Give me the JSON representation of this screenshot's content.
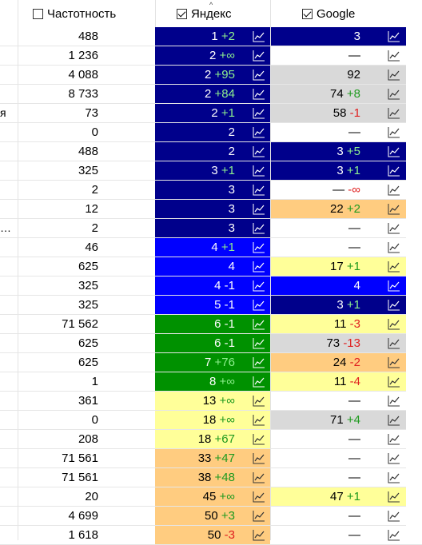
{
  "header": {
    "frequency_label": "Частотность",
    "frequency_checked": false,
    "yandex_label": "Яндекс",
    "yandex_checked": true,
    "google_label": "Google",
    "google_checked": true,
    "sort_indicator": "^"
  },
  "colors": {
    "navy": "#00008b",
    "blue": "#0000ff",
    "green": "#009100",
    "yellow": "#ffff99",
    "orange": "#ffcc80",
    "gray": "#d9d9d9",
    "delta_up": "#1f9a1f",
    "delta_down": "#e02020"
  },
  "rows": [
    {
      "kw": "",
      "freq": "488",
      "y": {
        "pos": "1",
        "d": "+2",
        "bg": "navy"
      },
      "g": {
        "pos": "3",
        "d": "",
        "bg": "navy"
      }
    },
    {
      "kw": "",
      "freq": "1 236",
      "y": {
        "pos": "2",
        "d": "+∞",
        "bg": "navy"
      },
      "g": {
        "pos": "—",
        "d": "",
        "bg": "white"
      }
    },
    {
      "kw": "",
      "freq": "4 088",
      "y": {
        "pos": "2",
        "d": "+95",
        "bg": "navy"
      },
      "g": {
        "pos": "92",
        "d": "",
        "bg": "gray"
      }
    },
    {
      "kw": "",
      "freq": "8 733",
      "y": {
        "pos": "2",
        "d": "+84",
        "bg": "navy"
      },
      "g": {
        "pos": "74",
        "d": "+8",
        "bg": "gray"
      }
    },
    {
      "kw": "я",
      "freq": "73",
      "y": {
        "pos": "2",
        "d": "+1",
        "bg": "navy"
      },
      "g": {
        "pos": "58",
        "d": "-1",
        "bg": "gray"
      }
    },
    {
      "kw": "",
      "freq": "0",
      "y": {
        "pos": "2",
        "d": "",
        "bg": "navy"
      },
      "g": {
        "pos": "—",
        "d": "",
        "bg": "white"
      }
    },
    {
      "kw": "",
      "freq": "488",
      "y": {
        "pos": "2",
        "d": "",
        "bg": "navy"
      },
      "g": {
        "pos": "3",
        "d": "+5",
        "bg": "navy"
      }
    },
    {
      "kw": "",
      "freq": "325",
      "y": {
        "pos": "3",
        "d": "+1",
        "bg": "navy"
      },
      "g": {
        "pos": "3",
        "d": "+1",
        "bg": "navy"
      }
    },
    {
      "kw": "",
      "freq": "2",
      "y": {
        "pos": "3",
        "d": "",
        "bg": "navy"
      },
      "g": {
        "pos": "—",
        "d": "-∞",
        "bg": "white"
      }
    },
    {
      "kw": "",
      "freq": "12",
      "y": {
        "pos": "3",
        "d": "",
        "bg": "navy"
      },
      "g": {
        "pos": "22",
        "d": "+2",
        "bg": "orange"
      }
    },
    {
      "kw": "…",
      "freq": "2",
      "y": {
        "pos": "3",
        "d": "",
        "bg": "navy"
      },
      "g": {
        "pos": "—",
        "d": "",
        "bg": "white"
      }
    },
    {
      "kw": "",
      "freq": "46",
      "y": {
        "pos": "4",
        "d": "+1",
        "bg": "blue"
      },
      "g": {
        "pos": "—",
        "d": "",
        "bg": "white"
      }
    },
    {
      "kw": "",
      "freq": "625",
      "y": {
        "pos": "4",
        "d": "",
        "bg": "blue"
      },
      "g": {
        "pos": "17",
        "d": "+1",
        "bg": "yellow"
      }
    },
    {
      "kw": "",
      "freq": "325",
      "y": {
        "pos": "4",
        "d": "-1",
        "bg": "blue"
      },
      "g": {
        "pos": "4",
        "d": "",
        "bg": "blue"
      }
    },
    {
      "kw": "",
      "freq": "325",
      "y": {
        "pos": "5",
        "d": "-1",
        "bg": "blue"
      },
      "g": {
        "pos": "3",
        "d": "+1",
        "bg": "navy"
      }
    },
    {
      "kw": "",
      "freq": "71 562",
      "y": {
        "pos": "6",
        "d": "-1",
        "bg": "green"
      },
      "g": {
        "pos": "11",
        "d": "-3",
        "bg": "yellow"
      }
    },
    {
      "kw": "",
      "freq": "625",
      "y": {
        "pos": "6",
        "d": "-1",
        "bg": "green"
      },
      "g": {
        "pos": "73",
        "d": "-13",
        "bg": "gray"
      }
    },
    {
      "kw": "",
      "freq": "625",
      "y": {
        "pos": "7",
        "d": "+76",
        "bg": "green"
      },
      "g": {
        "pos": "24",
        "d": "-2",
        "bg": "orange"
      }
    },
    {
      "kw": "",
      "freq": "1",
      "y": {
        "pos": "8",
        "d": "+∞",
        "bg": "green"
      },
      "g": {
        "pos": "11",
        "d": "-4",
        "bg": "yellow"
      }
    },
    {
      "kw": "",
      "freq": "361",
      "y": {
        "pos": "13",
        "d": "+∞",
        "bg": "yellow"
      },
      "g": {
        "pos": "—",
        "d": "",
        "bg": "white"
      }
    },
    {
      "kw": "",
      "freq": "0",
      "y": {
        "pos": "18",
        "d": "+∞",
        "bg": "yellow"
      },
      "g": {
        "pos": "71",
        "d": "+4",
        "bg": "gray"
      }
    },
    {
      "kw": "",
      "freq": "208",
      "y": {
        "pos": "18",
        "d": "+67",
        "bg": "yellow"
      },
      "g": {
        "pos": "—",
        "d": "",
        "bg": "white"
      }
    },
    {
      "kw": "",
      "freq": "71 561",
      "y": {
        "pos": "33",
        "d": "+47",
        "bg": "orange"
      },
      "g": {
        "pos": "—",
        "d": "",
        "bg": "white"
      }
    },
    {
      "kw": "",
      "freq": "71 561",
      "y": {
        "pos": "38",
        "d": "+48",
        "bg": "orange"
      },
      "g": {
        "pos": "—",
        "d": "",
        "bg": "white"
      }
    },
    {
      "kw": "",
      "freq": "20",
      "y": {
        "pos": "45",
        "d": "+∞",
        "bg": "orange"
      },
      "g": {
        "pos": "47",
        "d": "+1",
        "bg": "yellow"
      }
    },
    {
      "kw": "",
      "freq": "4 699",
      "y": {
        "pos": "50",
        "d": "+3",
        "bg": "orange"
      },
      "g": {
        "pos": "—",
        "d": "",
        "bg": "white"
      }
    },
    {
      "kw": "",
      "freq": "1 618",
      "y": {
        "pos": "50",
        "d": "-3",
        "bg": "orange"
      },
      "g": {
        "pos": "—",
        "d": "",
        "bg": "white"
      }
    }
  ]
}
